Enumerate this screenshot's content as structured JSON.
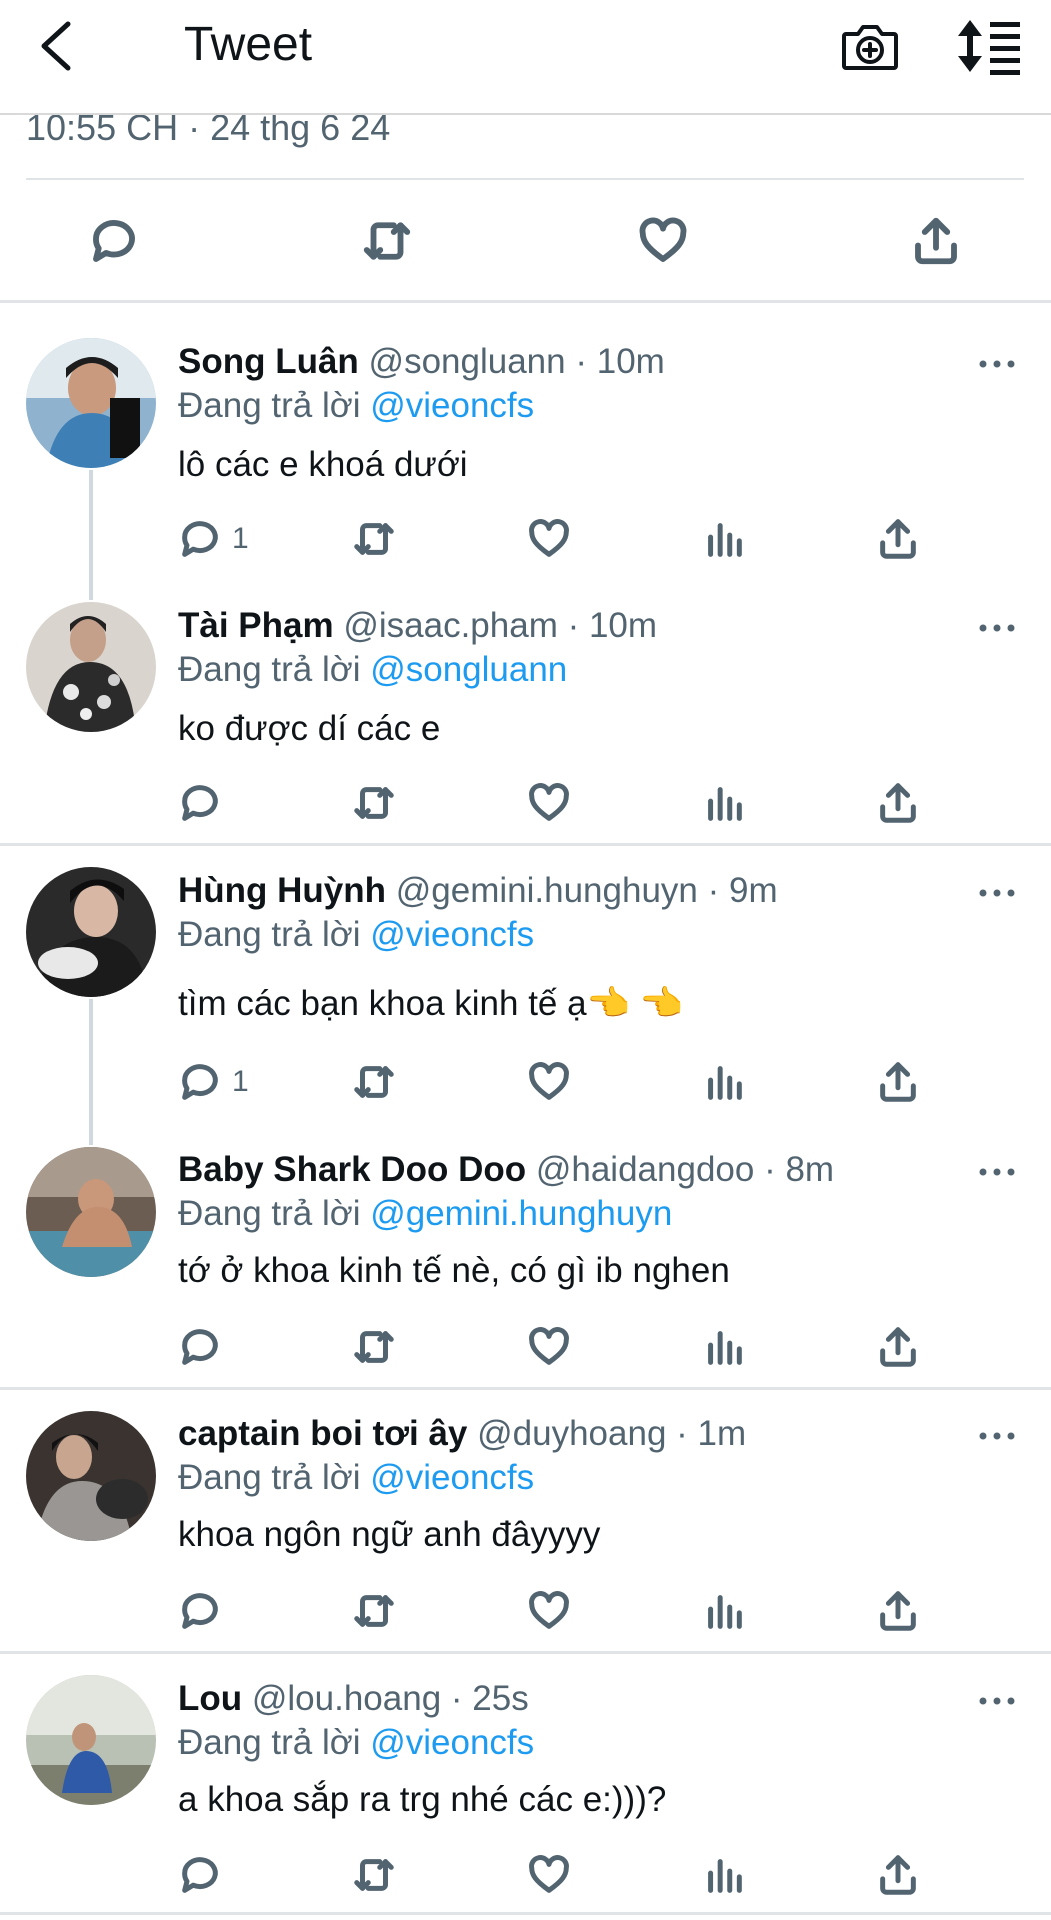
{
  "header": {
    "title": "Tweet",
    "back_icon": "back-chevron-icon",
    "camera_icon": "camera-plus-icon",
    "sort_icon": "sort-list-icon"
  },
  "main_tweet": {
    "timestamp": "10:55 CH · 24 thg 6 24",
    "actions": [
      "reply-icon",
      "retweet-icon",
      "like-icon",
      "share-icon"
    ]
  },
  "reply_prefix": "Đang trả lời",
  "colors": {
    "link": "#1d9bf0",
    "muted": "#536471",
    "text": "#0f1419",
    "divider": "#e1e4e6"
  },
  "replies": [
    {
      "name": "Song Luân",
      "handle": "@songluann",
      "time": "10m",
      "replying_to": "@vieoncfs",
      "text": "lô các e khoá dưới",
      "reply_count": "1"
    },
    {
      "name": "Tài Phạm",
      "handle": "@isaac.pham",
      "time": "10m",
      "replying_to": "@songluann",
      "text": "ko được dí các e",
      "reply_count": ""
    },
    {
      "name": "Hùng Huỳnh",
      "handle": "@gemini.hunghuyn",
      "time": "9m",
      "replying_to": "@vieoncfs",
      "text": "tìm các bạn khoa kinh tế ạ👈 👈",
      "reply_count": "1"
    },
    {
      "name": "Baby Shark Doo Doo",
      "handle": "@haidangdoo",
      "time": "8m",
      "replying_to": "@gemini.hunghuyn",
      "text": "tớ ở khoa kinh tế nè, có gì ib nghen",
      "reply_count": ""
    },
    {
      "name": "captain boi tơi ây",
      "handle": "@duyhoang",
      "time": "1m",
      "replying_to": "@vieoncfs",
      "text": "khoa ngôn ngữ anh đâyyyy",
      "reply_count": ""
    },
    {
      "name": "Lou",
      "handle": "@lou.hoang",
      "time": "25s",
      "replying_to": "@vieoncfs",
      "text": "a khoa sắp ra trg nhé các e:)))?",
      "reply_count": ""
    }
  ]
}
